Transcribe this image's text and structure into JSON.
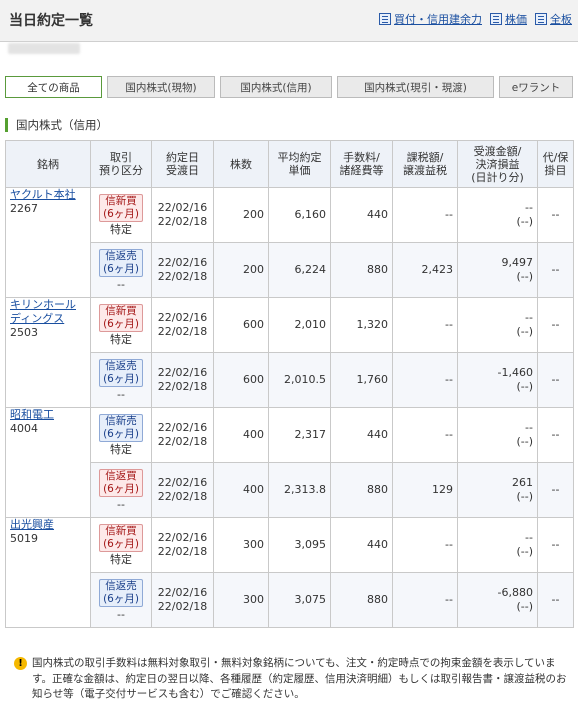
{
  "header": {
    "title": "当日約定一覧",
    "links": [
      {
        "label": "買付・信用建余力",
        "icon": "list-icon"
      },
      {
        "label": "株価",
        "icon": "list-icon"
      },
      {
        "label": "全板",
        "icon": "list-icon"
      }
    ]
  },
  "tabs": [
    "全ての商品",
    "国内株式(現物)",
    "国内株式(信用)",
    "国内株式(現引・現渡)",
    "eワラント"
  ],
  "section_title": "国内株式（信用）",
  "columns": {
    "name": "銘柄",
    "cat": [
      "取引",
      "預り区分"
    ],
    "date": [
      "約定日",
      "受渡日"
    ],
    "qty": "株数",
    "price": [
      "平均約定",
      "単価"
    ],
    "fee": [
      "手数料/",
      "諸経費等"
    ],
    "tax": [
      "課税額/",
      "譲渡益税"
    ],
    "recv": [
      "受渡金額/",
      "決済損益",
      "(日計り分)"
    ],
    "misc": [
      "代/保",
      "掛目"
    ]
  },
  "rows": [
    {
      "name": "ヤクルト本社",
      "code": "2267",
      "r1": {
        "badge": "信新買",
        "term": "(6ヶ月)",
        "acct": "特定",
        "trade": "22/02/16",
        "settle": "22/02/18",
        "qty": "200",
        "price": "6,160",
        "fee": "440",
        "tax": "--",
        "recv": "--",
        "recv2": "(--)",
        "misc": "--"
      },
      "r2": {
        "badge": "信返売",
        "term": "(6ヶ月)",
        "acct": "--",
        "trade": "22/02/16",
        "settle": "22/02/18",
        "qty": "200",
        "price": "6,224",
        "fee": "880",
        "tax": "2,423",
        "recv": "9,497",
        "recv2": "(--)",
        "misc": "--"
      }
    },
    {
      "name": "キリンホール ディングス",
      "code": "2503",
      "r1": {
        "badge": "信新買",
        "term": "(6ヶ月)",
        "acct": "特定",
        "trade": "22/02/16",
        "settle": "22/02/18",
        "qty": "600",
        "price": "2,010",
        "fee": "1,320",
        "tax": "--",
        "recv": "--",
        "recv2": "(--)",
        "misc": "--"
      },
      "r2": {
        "badge": "信返売",
        "term": "(6ヶ月)",
        "acct": "--",
        "trade": "22/02/16",
        "settle": "22/02/18",
        "qty": "600",
        "price": "2,010.5",
        "fee": "1,760",
        "tax": "--",
        "recv": "-1,460",
        "recv2": "(--)",
        "misc": "--"
      }
    },
    {
      "name": "昭和電工",
      "code": "4004",
      "r1": {
        "badge": "信新売",
        "term": "(6ヶ月)",
        "acct": "特定",
        "trade": "22/02/16",
        "settle": "22/02/18",
        "qty": "400",
        "price": "2,317",
        "fee": "440",
        "tax": "--",
        "recv": "--",
        "recv2": "(--)",
        "misc": "--"
      },
      "r2": {
        "badge": "信返買",
        "term": "(6ヶ月)",
        "acct": "--",
        "trade": "22/02/16",
        "settle": "22/02/18",
        "qty": "400",
        "price": "2,313.8",
        "fee": "880",
        "tax": "129",
        "recv": "261",
        "recv2": "(--)",
        "misc": "--"
      }
    },
    {
      "name": "出光興産",
      "code": "5019",
      "r1": {
        "badge": "信新買",
        "term": "(6ヶ月)",
        "acct": "特定",
        "trade": "22/02/16",
        "settle": "22/02/18",
        "qty": "300",
        "price": "3,095",
        "fee": "440",
        "tax": "--",
        "recv": "--",
        "recv2": "(--)",
        "misc": "--"
      },
      "r2": {
        "badge": "信返売",
        "term": "(6ヶ月)",
        "acct": "--",
        "trade": "22/02/16",
        "settle": "22/02/18",
        "qty": "300",
        "price": "3,075",
        "fee": "880",
        "tax": "--",
        "recv": "-6,880",
        "recv2": "(--)",
        "misc": "--"
      }
    }
  ],
  "notice": "国内株式の取引手数料は無料対象取引・無料対象銘柄についても、注文・約定時点での拘束金額を表示しています。正確な金額は、約定日の翌日以降、各種履歴（約定履歴、信用決済明細）もしくは取引報告書・譲渡益税のお知らせ等（電子交付サービスも含む）でご確認ください。"
}
